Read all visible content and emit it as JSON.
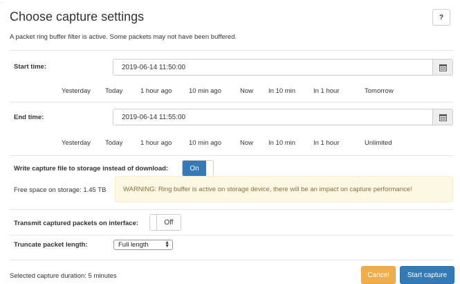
{
  "dialog": {
    "title": "Choose capture settings",
    "help_label": "?",
    "subtitle": "A packet ring buffer filter is active. Some packets may not have been buffered."
  },
  "start": {
    "label": "Start time:",
    "value": "2019-06-14 11:50:00",
    "quick": [
      "Yesterday",
      "Today",
      "1 hour ago",
      "10 min ago",
      "Now",
      "In 10 min",
      "In 1 hour",
      "Tomorrow"
    ]
  },
  "end": {
    "label": "End time:",
    "value": "2019-06-14 11:55:00",
    "quick": [
      "Yesterday",
      "Today",
      "1 hour ago",
      "10 min ago",
      "Now",
      "In 10 min",
      "In 1 hour",
      "Unlimited"
    ]
  },
  "storage": {
    "label": "Write capture file to storage instead of download:",
    "toggle_state": "On",
    "free_space": "Free space on storage: 1.45 TB",
    "warning": "WARNING: Ring buffer is active on storage device, there will be an impact on capture performance!"
  },
  "transmit": {
    "label": "Transmit captured packets on interface:",
    "toggle_state": "Off"
  },
  "truncate": {
    "label": "Truncate packet length:",
    "selected": "Full length"
  },
  "footer": {
    "duration": "Selected capture duration: 5 minutes",
    "cancel_label": "Cancel",
    "start_label": "Start capture"
  },
  "colors": {
    "primary": "#337ab7",
    "warning_button": "#f0ad4e",
    "warning_bg": "#fcf8e3",
    "warning_text": "#8a6d3b"
  },
  "icons": {
    "calendar": "calendar-icon",
    "select_arrows": "select-arrows-icon"
  }
}
